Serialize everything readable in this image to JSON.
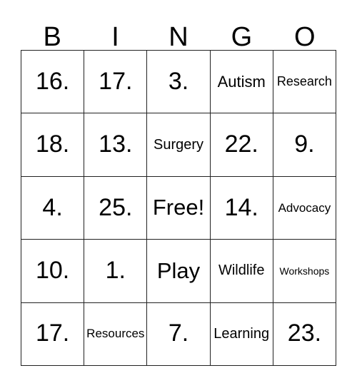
{
  "card": {
    "headers": [
      "B",
      "I",
      "N",
      "G",
      "O"
    ],
    "rows": [
      [
        {
          "text": "16.",
          "size": "fs-num"
        },
        {
          "text": "17.",
          "size": "fs-num"
        },
        {
          "text": "3.",
          "size": "fs-num"
        },
        {
          "text": "Autism",
          "size": "fs-t22"
        },
        {
          "text": "Research",
          "size": "fs-t18"
        }
      ],
      [
        {
          "text": "18.",
          "size": "fs-num"
        },
        {
          "text": "13.",
          "size": "fs-num"
        },
        {
          "text": "Surgery",
          "size": "fs-t20"
        },
        {
          "text": "22.",
          "size": "fs-num"
        },
        {
          "text": "9.",
          "size": "fs-num"
        }
      ],
      [
        {
          "text": "4.",
          "size": "fs-num"
        },
        {
          "text": "25.",
          "size": "fs-num"
        },
        {
          "text": "Free!",
          "size": "fs-free"
        },
        {
          "text": "14.",
          "size": "fs-num"
        },
        {
          "text": "Advocacy",
          "size": "fs-t17"
        }
      ],
      [
        {
          "text": "10.",
          "size": "fs-num"
        },
        {
          "text": "1.",
          "size": "fs-num"
        },
        {
          "text": "Play",
          "size": "fs-play"
        },
        {
          "text": "Wildlife",
          "size": "fs-t20"
        },
        {
          "text": "Workshops",
          "size": "fs-t14"
        }
      ],
      [
        {
          "text": "17.",
          "size": "fs-num"
        },
        {
          "text": "Resources",
          "size": "fs-t17"
        },
        {
          "text": "7.",
          "size": "fs-num"
        },
        {
          "text": "Learning",
          "size": "fs-t20"
        },
        {
          "text": "23.",
          "size": "fs-num"
        }
      ]
    ]
  },
  "colors": {
    "grid_line": "#222222",
    "text": "#000000",
    "background": "#ffffff"
  }
}
